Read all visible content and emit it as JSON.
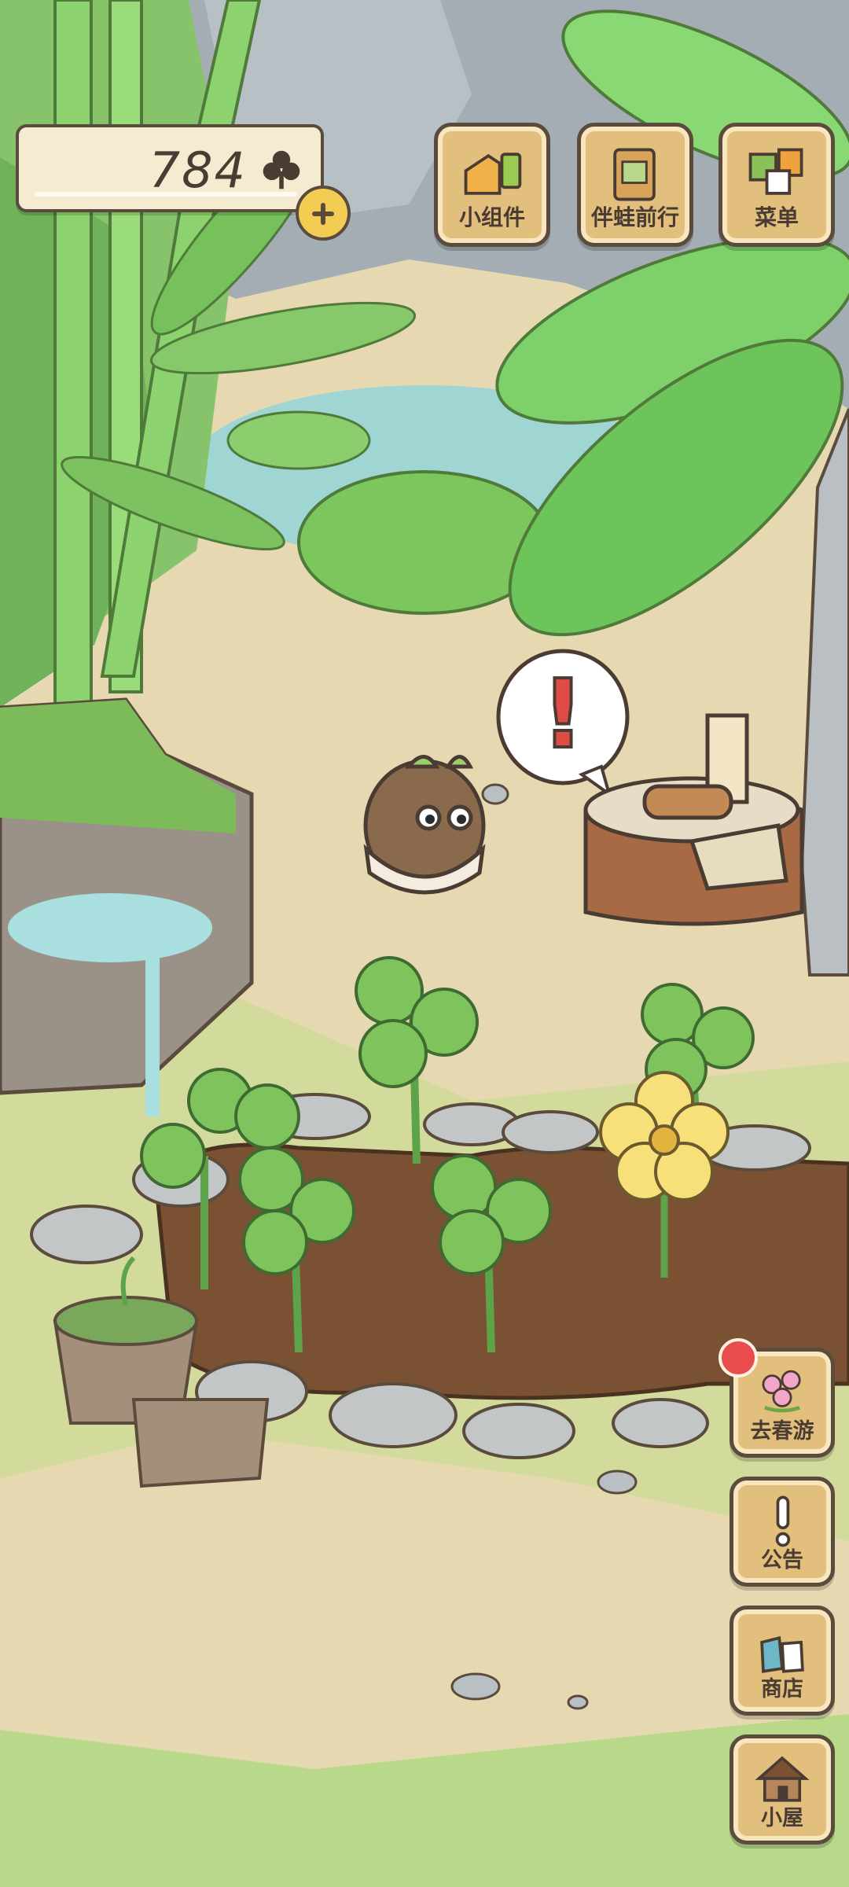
{
  "hud": {
    "clover_count": "784"
  },
  "top_menu": {
    "widgets_label": "小组件",
    "travel_label": "伴蛙前行",
    "menu_label": "菜单"
  },
  "side_menu": {
    "spring_trip_label": "去春游",
    "notice_label": "公告",
    "shop_label": "商店",
    "house_label": "小屋"
  },
  "scene": {
    "alert_symbol": "!"
  },
  "colors": {
    "ground": "#e6d9b2",
    "grass": "#a9cf75",
    "soil": "#7a5233",
    "clover": "#7fc35c",
    "wood": "#e3bf7e",
    "outline": "#5a4b3d",
    "badge": "#e84c4c"
  }
}
